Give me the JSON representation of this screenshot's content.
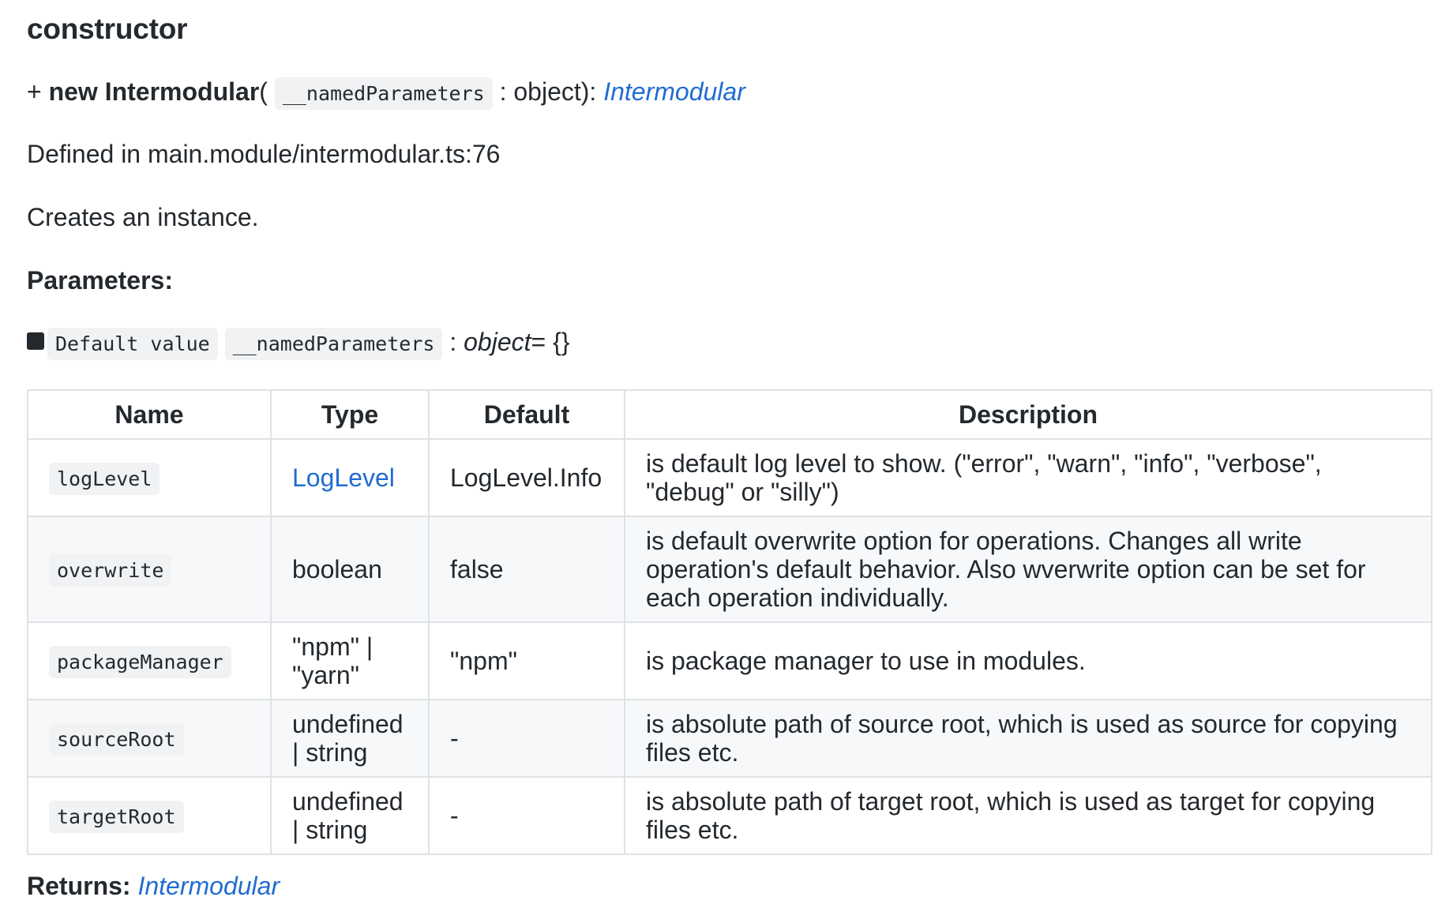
{
  "heading": "constructor",
  "signature": {
    "prefix": "+ ",
    "keyword": "new Intermodular",
    "open_paren": "(",
    "param": "__namedParameters",
    "param_type": ": object): ",
    "return_type": "Intermodular"
  },
  "defined_in": "Defined in main.module/intermodular.ts:76",
  "description": "Creates an instance.",
  "parameters_label": "Parameters:",
  "default_param": {
    "badge": "Default value",
    "name": "__namedParameters",
    "sep": " : ",
    "type": "object",
    "default": "= {}"
  },
  "table": {
    "headers": [
      "Name",
      "Type",
      "Default",
      "Description"
    ],
    "rows": [
      {
        "name": "logLevel",
        "type": "LogLevel",
        "default": "LogLevel.Info",
        "description": "is default log level to show. (\"error\", \"warn\", \"info\", \"verbose\", \"debug\" or \"silly\")"
      },
      {
        "name": "overwrite",
        "type": "boolean",
        "default": "false",
        "description": "is default overwrite option for operations. Changes all write operation's default behavior. Also wverwrite option can be set for each operation individually."
      },
      {
        "name": "packageManager",
        "type": "\"npm\" | \"yarn\"",
        "default": "\"npm\"",
        "description": "is package manager to use in modules."
      },
      {
        "name": "sourceRoot",
        "type": "undefined | string",
        "default": "-",
        "description": "is absolute path of source root, which is used as source for copying files etc."
      },
      {
        "name": "targetRoot",
        "type": "undefined | string",
        "default": "-",
        "description": "is absolute path of target root, which is used as target for copying files etc."
      }
    ]
  },
  "returns": {
    "label": "Returns:",
    "type": "Intermodular"
  },
  "colors": {
    "link": "#1f6cd1",
    "text": "#24292e",
    "code_bg": "#f1f2f3",
    "alt_row": "#f6f8fa",
    "border": "#dfe2e5"
  }
}
